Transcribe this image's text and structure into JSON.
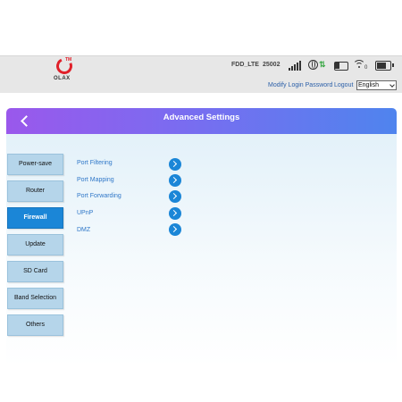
{
  "brand": {
    "name": "OLAX",
    "mark": "TM"
  },
  "status_bar": {
    "network_type": "FDD_LTE",
    "operator_code": "25002",
    "wifi_clients": "0",
    "icons": [
      "signal-icon",
      "data-transfer-icon",
      "sms-icon",
      "wifi-icon",
      "battery-icon"
    ],
    "battery_level": 0.8
  },
  "top_links": {
    "modify_password": "Modify Login Password",
    "logout": "Logout"
  },
  "language": {
    "selected": "English"
  },
  "header": {
    "title": "Advanced Settings"
  },
  "sidebar": {
    "items": [
      {
        "label": "Power-save",
        "active": false
      },
      {
        "label": "Router",
        "active": false
      },
      {
        "label": "Firewall",
        "active": true
      },
      {
        "label": "Update",
        "active": false
      },
      {
        "label": "SD Card",
        "active": false
      },
      {
        "label": "Band Selection",
        "active": false
      },
      {
        "label": "Others",
        "active": false
      }
    ]
  },
  "firewall_menu": {
    "items": [
      {
        "label": "Port Filtering"
      },
      {
        "label": "Port Mapping"
      },
      {
        "label": "Port Forwarding"
      },
      {
        "label": "UPnP"
      },
      {
        "label": "DMZ"
      }
    ]
  },
  "colors": {
    "accent": "#1b86d7",
    "header_start": "#9a58ec",
    "header_end": "#4f84ee",
    "logo_red": "#e0202a",
    "link": "#2b5fa8"
  }
}
